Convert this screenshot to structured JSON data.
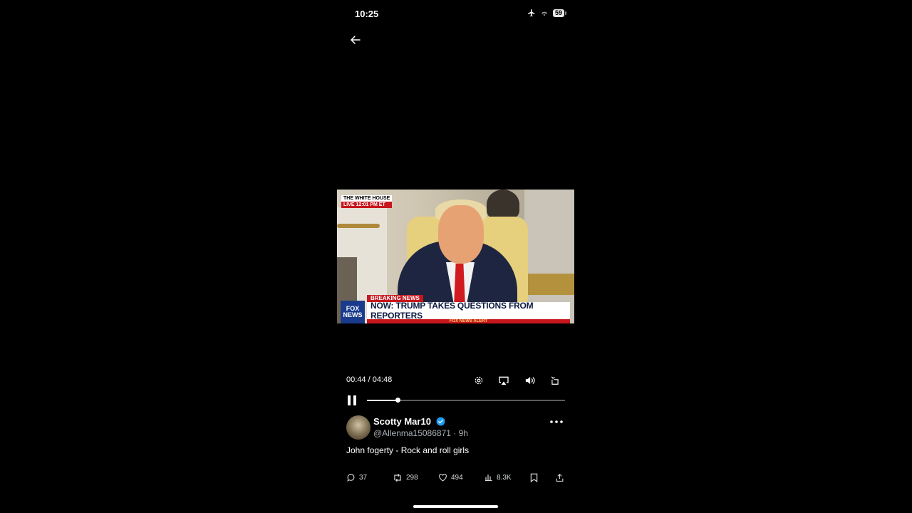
{
  "status_bar": {
    "time": "10:25",
    "battery": "59",
    "icons": [
      "airplane-icon",
      "wifi-icon",
      "battery-icon"
    ]
  },
  "navigation": {
    "back_icon": "arrow-left-icon"
  },
  "video": {
    "overlay": {
      "location": "THE WHITE HOUSE",
      "live": "LIVE",
      "timestamp": "12:01 PM ET",
      "breaking": "BREAKING NEWS",
      "headline": "NOW: TRUMP TAKES QUESTIONS FROM REPORTERS",
      "network_line1": "FOX",
      "network_line2": "NEWS",
      "alert": "FOX NEWS ALERT"
    },
    "current_time": "00:44",
    "duration": "04:48",
    "time_readout": "00:44 / 04:48",
    "progress_fraction": 0.153,
    "controls": [
      "settings-icon",
      "airplay-icon",
      "volume-icon",
      "rotate-icon"
    ],
    "playing": true
  },
  "tweet": {
    "display_name": "Scotty Mar10",
    "verified": true,
    "handle_line": "@Allenma15086871 · 9h",
    "text": "John fogerty - Rock and roll girls",
    "stats": {
      "replies": "37",
      "retweets": "298",
      "likes": "494",
      "views": "8.3K"
    }
  },
  "colors": {
    "background": "#000000",
    "accent": "#1d9bf0",
    "breaking_red": "#c8161d",
    "muted_text": "#aab0b6"
  }
}
